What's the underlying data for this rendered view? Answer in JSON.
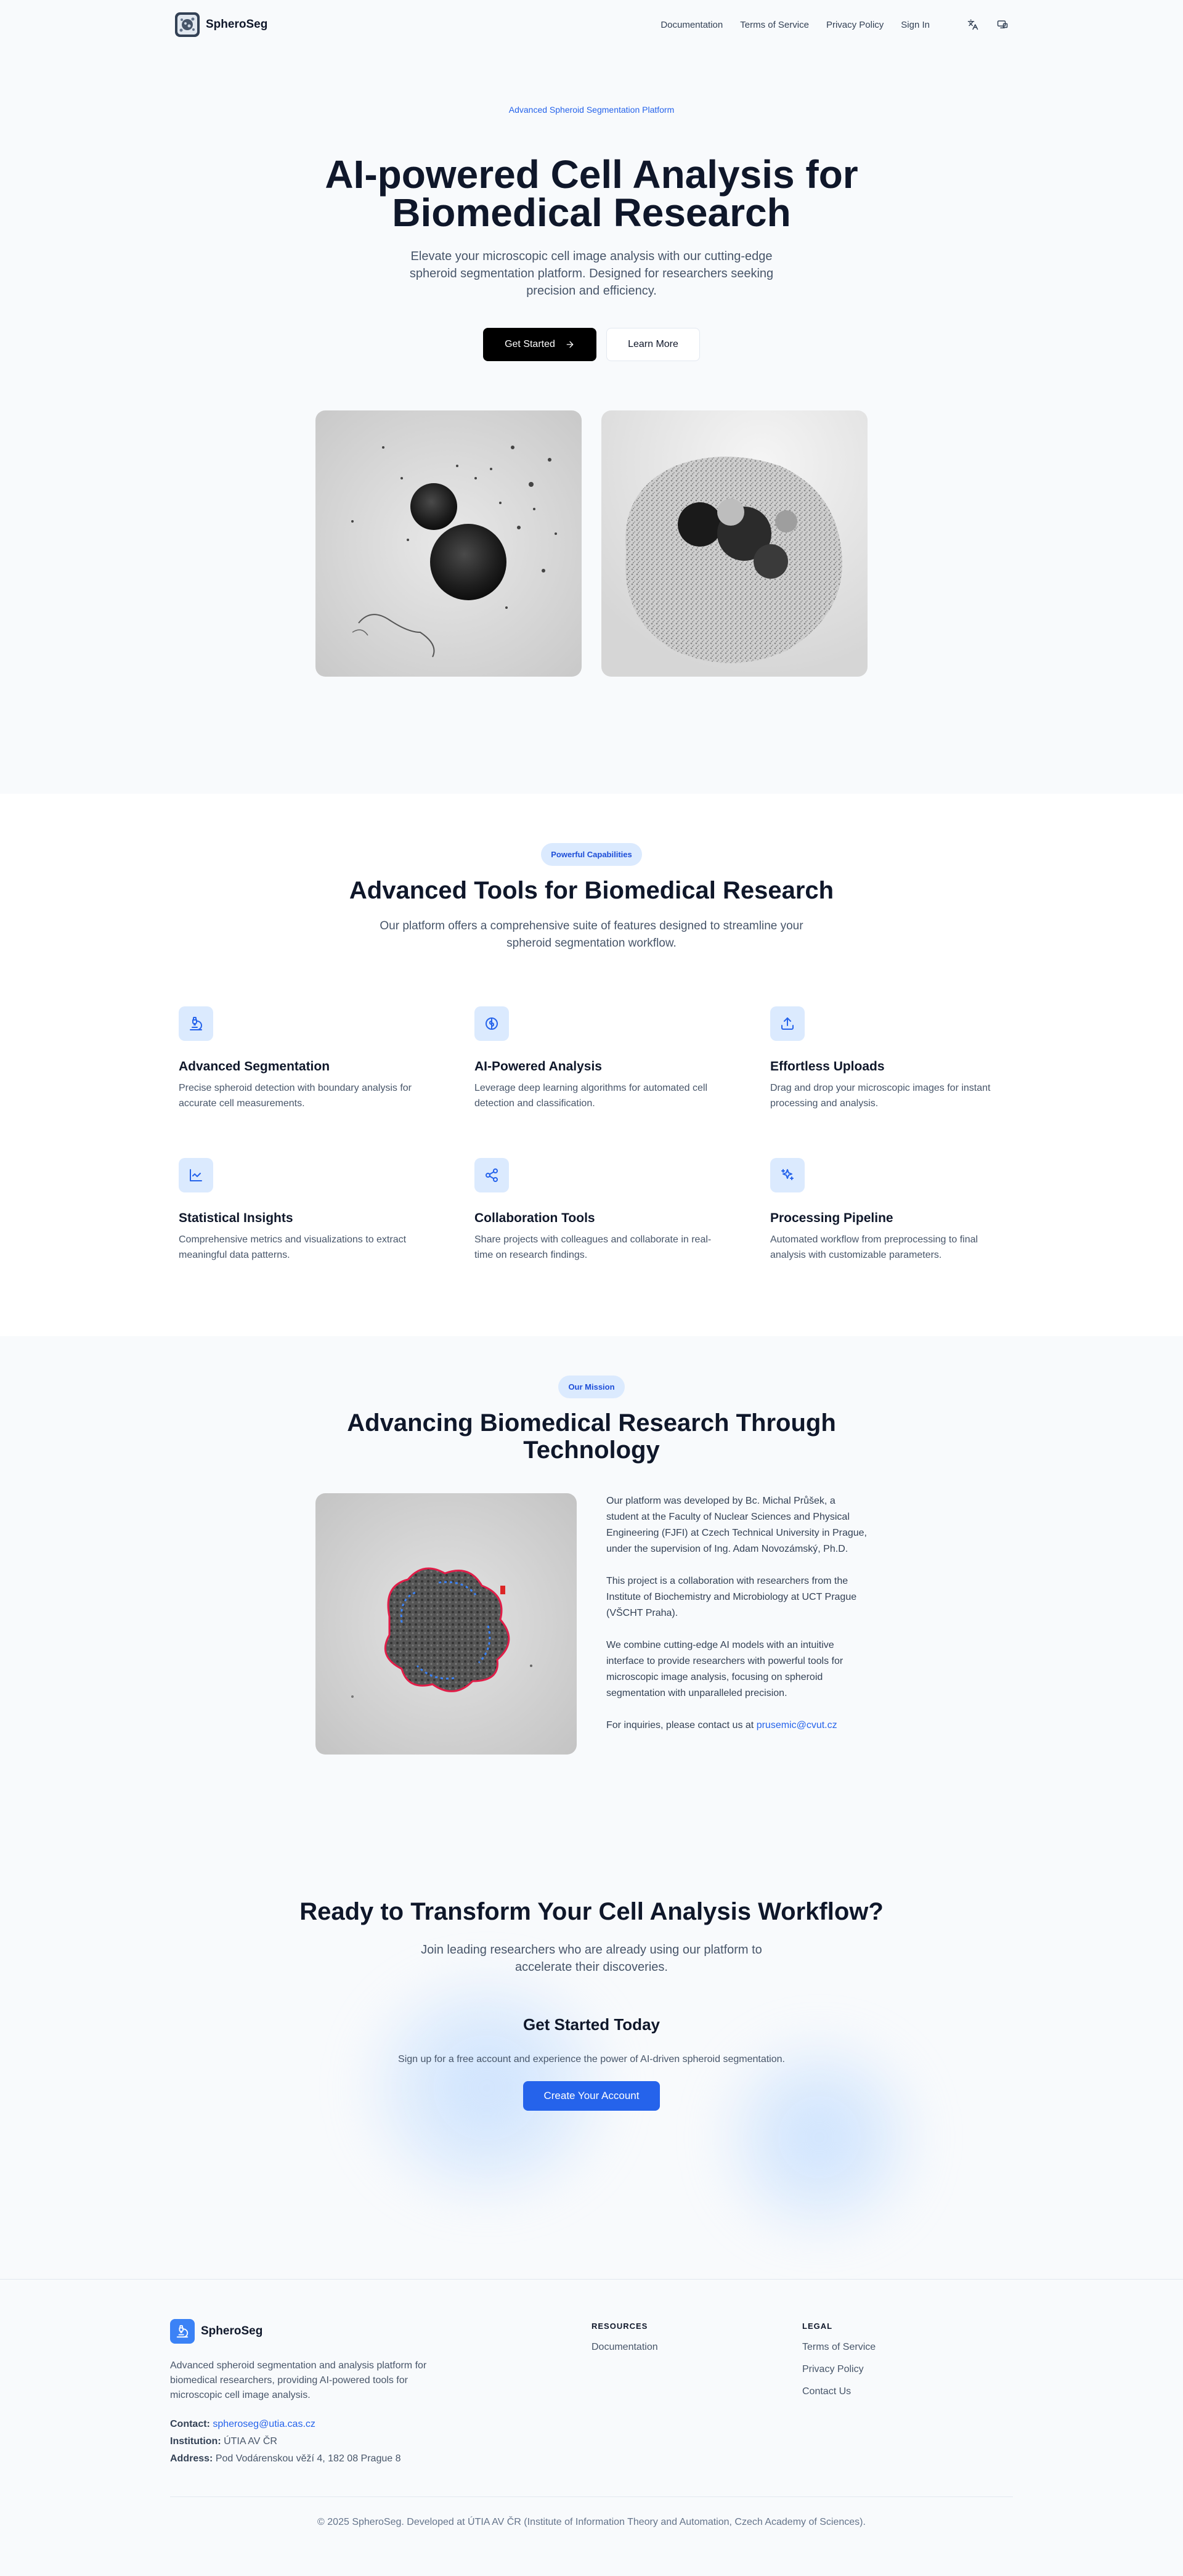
{
  "nav": {
    "brand": "SpheroSeg",
    "links": [
      "Documentation",
      "Terms of Service",
      "Privacy Policy",
      "Sign In"
    ],
    "icons": [
      "language-icon",
      "theme-icon"
    ]
  },
  "hero": {
    "tag": "Advanced Spheroid Segmentation Platform",
    "title_line1": "AI-powered Cell Analysis for",
    "title_line2": "Biomedical Research",
    "subtitle": "Elevate your microscopic cell image analysis with our cutting-edge spheroid segmentation platform. Designed for researchers seeking precision and efficiency.",
    "primary_button": "Get Started",
    "secondary_button": "Learn More"
  },
  "features": {
    "pill": "Powerful Capabilities",
    "title": "Advanced Tools for Biomedical Research",
    "subtitle": "Our platform offers a comprehensive suite of features designed to streamline your spheroid segmentation workflow.",
    "items": [
      {
        "title": "Advanced Segmentation",
        "desc": "Precise spheroid detection with boundary analysis for accurate cell measurements.",
        "icon": "microscope-icon"
      },
      {
        "title": "AI-Powered Analysis",
        "desc": "Leverage deep learning algorithms for automated cell detection and classification.",
        "icon": "brain-icon"
      },
      {
        "title": "Effortless Uploads",
        "desc": "Drag and drop your microscopic images for instant processing and analysis.",
        "icon": "upload-icon"
      },
      {
        "title": "Statistical Insights",
        "desc": "Comprehensive metrics and visualizations to extract meaningful data patterns.",
        "icon": "chart-icon"
      },
      {
        "title": "Collaboration Tools",
        "desc": "Share projects with colleagues and collaborate in real-time on research findings.",
        "icon": "share-icon"
      },
      {
        "title": "Processing Pipeline",
        "desc": "Automated workflow from preprocessing to final analysis with customizable parameters.",
        "icon": "sparkles-icon"
      }
    ]
  },
  "mission": {
    "pill": "Our Mission",
    "title_line1": "Advancing Biomedical Research Through",
    "title_line2": "Technology",
    "paragraphs": [
      "Our platform was developed by Bc. Michal Průšek, a student at the Faculty of Nuclear Sciences and Physical Engineering (FJFI) at Czech Technical University in Prague, under the supervision of Ing. Adam Novozámský, Ph.D.",
      "This project is a collaboration with researchers from the Institute of Biochemistry and Microbiology at UCT Prague (VŠCHT Praha).",
      "We combine cutting-edge AI models with an intuitive interface to provide researchers with powerful tools for microscopic image analysis, focusing on spheroid segmentation with unparalleled precision."
    ],
    "contact_prefix": "For inquiries, please contact us at ",
    "contact_email": "prusemic@cvut.cz"
  },
  "cta": {
    "title": "Ready to Transform Your Cell Analysis Workflow?",
    "subtitle": "Join leading researchers who are already using our platform to accelerate their discoveries.",
    "box_title": "Get Started Today",
    "box_text": "Sign up for a free account and experience the power of AI-driven spheroid segmentation.",
    "button": "Create Your Account"
  },
  "footer": {
    "brand": "SpheroSeg",
    "description": "Advanced spheroid segmentation and analysis platform for biomedical researchers, providing AI-powered tools for microscopic cell image analysis.",
    "contact_label": "Contact:",
    "contact_value": "spheroseg@utia.cas.cz",
    "institution_label": "Institution:",
    "institution_value": "ÚTIA AV ČR",
    "address_label": "Address:",
    "address_value": "Pod Vodárenskou věží 4, 182 08 Prague 8",
    "resources_heading": "RESOURCES",
    "resources_links": [
      "Documentation"
    ],
    "legal_heading": "LEGAL",
    "legal_links": [
      "Terms of Service",
      "Privacy Policy",
      "Contact Us"
    ],
    "copyright": "© 2025 SpheroSeg. Developed at ÚTIA AV ČR (Institute of Information Theory and Automation, Czech Academy of Sciences)."
  }
}
